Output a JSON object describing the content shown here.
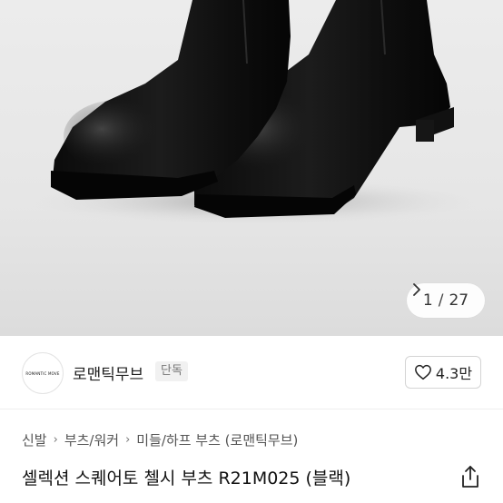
{
  "gallery": {
    "current": "1",
    "separator": "/",
    "total": "27",
    "next_icon": "chevron-right-icon"
  },
  "brand": {
    "logo_text": "ROMANTIC MOVE",
    "name": "로맨틱무브",
    "badge": "단독",
    "like_count": "4.3만",
    "like_icon": "heart-outline-icon"
  },
  "breadcrumb": {
    "items": [
      "신발",
      "부츠/워커",
      "미들/하프 부츠 (로맨틱무브)"
    ]
  },
  "product": {
    "title": "셀렉션 스퀘어토 첼시 부츠 R21M025 (블랙)",
    "share_icon": "share-icon"
  }
}
